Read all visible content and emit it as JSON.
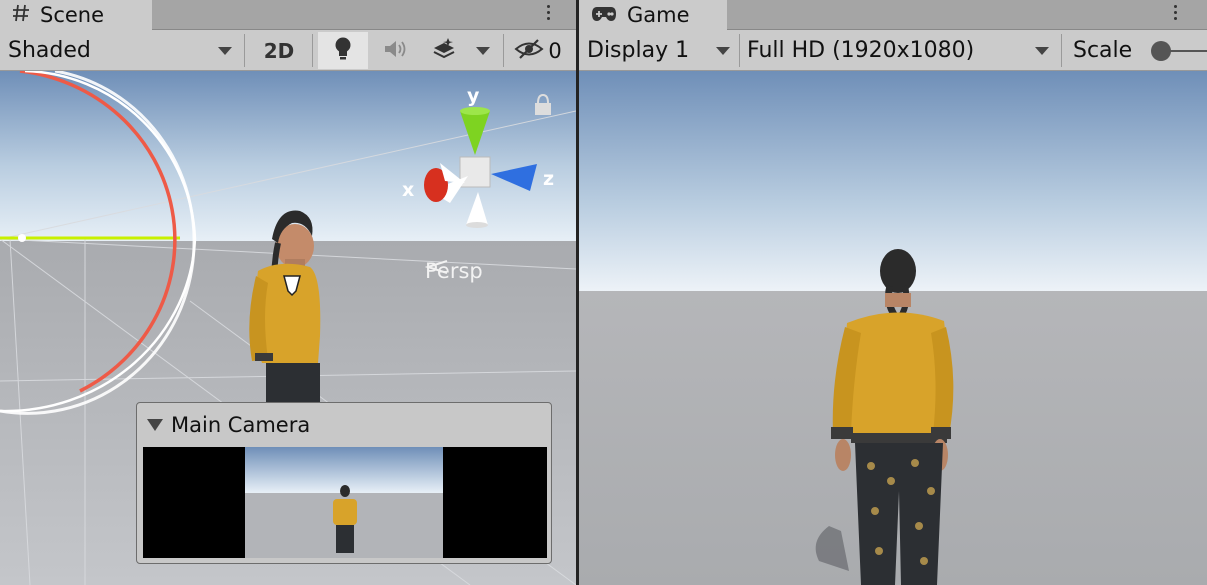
{
  "scene_tab": {
    "title": "Scene",
    "icon": "hash-icon"
  },
  "scene_toolbar": {
    "shading_mode": "Shaded",
    "mode_2d_label": "2D",
    "lighting_icon": "lightbulb-icon",
    "audio_icon": "speaker-icon",
    "effects_icon": "layers-icon",
    "hidden_icon": "eye-slash-icon",
    "hidden_count": "0"
  },
  "scene_view": {
    "gizmo": {
      "x_label": "x",
      "y_label": "y",
      "z_label": "z"
    },
    "projection_label": "Persp",
    "lock_icon": "lock-icon"
  },
  "camera_preview": {
    "title": "Main Camera"
  },
  "game_tab": {
    "title": "Game",
    "icon": "gamepad-icon"
  },
  "game_toolbar": {
    "display": "Display 1",
    "resolution": "Full HD (1920x1080)",
    "scale_label": "Scale"
  },
  "colors": {
    "sky_top": "#6f8fb8",
    "sky_horizon": "#e8f0f7",
    "ground": "#b2b4b8",
    "sweater": "#d8a32a",
    "gizmo_x": "#d7301f",
    "gizmo_y": "#7ed321",
    "gizmo_z": "#2f6fe0"
  }
}
